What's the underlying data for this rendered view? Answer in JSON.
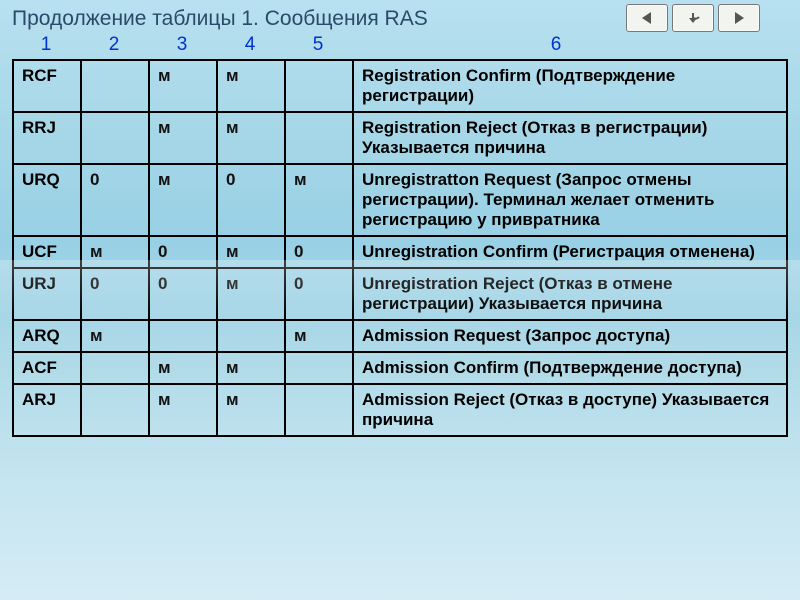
{
  "title": "Продолжение таблицы 1. Сообщения RAS",
  "columns": [
    "1",
    "2",
    "3",
    "4",
    "5",
    "6"
  ],
  "rows": [
    {
      "code": "RCF",
      "c2": "",
      "c3": "м",
      "c4": "м",
      "c5": "",
      "desc": "Registration Confirm (Подтверждение регистрации)"
    },
    {
      "code": "RRJ",
      "c2": "",
      "c3": "м",
      "c4": "м",
      "c5": "",
      "desc": "Registration Reject (Отказ в регистрации) Указывается причина"
    },
    {
      "code": "URQ",
      "c2": "0",
      "c3": "м",
      "c4": "0",
      "c5": "м",
      "desc": "Unregistratton Request (Запрос отмены регистрации). Терминал желает отменить регистрацию у привратника"
    },
    {
      "code": "UCF",
      "c2": "м",
      "c3": "0",
      "c4": "м",
      "c5": "0",
      "desc": "Unregistration Confirm (Регистрация отменена)"
    },
    {
      "code": "URJ",
      "c2": "0",
      "c3": "0",
      "c4": "м",
      "c5": "0",
      "desc": "Unregistration Reject (Отказ в отмене регистрации) Указывается причина"
    },
    {
      "code": "ARQ",
      "c2": "м",
      "c3": "",
      "c4": "",
      "c5": "м",
      "desc": "Admission Request (Запрос доступа)"
    },
    {
      "code": "ACF",
      "c2": "",
      "c3": "м",
      "c4": "м",
      "c5": "",
      "desc": "Admission Confirm (Подтверждение доступа)"
    },
    {
      "code": "ARJ",
      "c2": "",
      "c3": "м",
      "c4": "м",
      "c5": "",
      "desc": "Admission Reject (Отказ в доступе) Указывается причина"
    }
  ]
}
